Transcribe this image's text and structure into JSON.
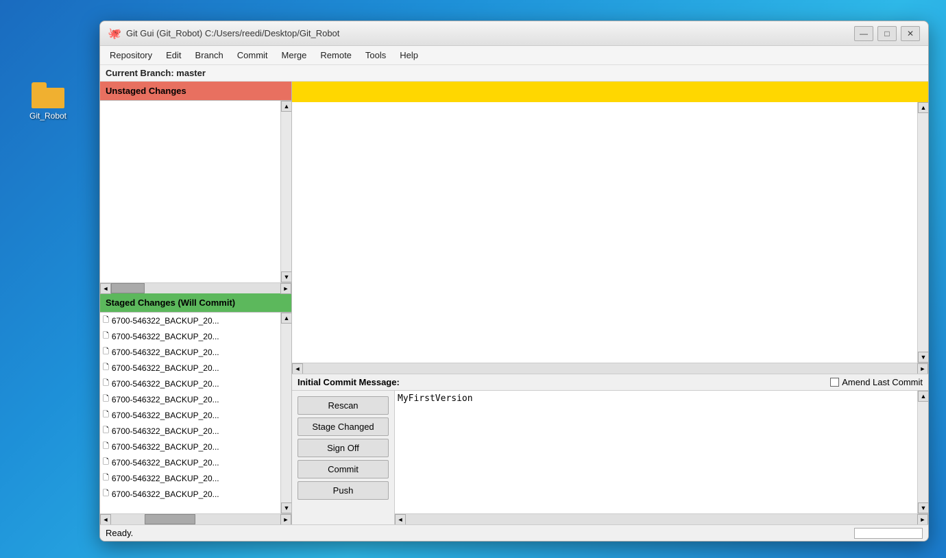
{
  "desktop": {
    "folder_label": "Git_Robot"
  },
  "window": {
    "title": "Git Gui (Git_Robot) C:/Users/reedi/Desktop/Git_Robot",
    "icon": "🐙"
  },
  "titlebar_buttons": {
    "minimize": "—",
    "maximize": "□",
    "close": "✕"
  },
  "menubar": {
    "items": [
      "Repository",
      "Edit",
      "Branch",
      "Commit",
      "Merge",
      "Remote",
      "Tools",
      "Help"
    ]
  },
  "branchbar": {
    "label": "Current Branch: master"
  },
  "left_panel": {
    "unstaged_header": "Unstaged Changes",
    "staged_header": "Staged Changes (Will Commit)",
    "staged_files": [
      "6700-546322_BACKUP_20...",
      "6700-546322_BACKUP_20...",
      "6700-546322_BACKUP_20...",
      "6700-546322_BACKUP_20...",
      "6700-546322_BACKUP_20...",
      "6700-546322_BACKUP_20...",
      "6700-546322_BACKUP_20...",
      "6700-546322_BACKUP_20...",
      "6700-546322_BACKUP_20...",
      "6700-546322_BACKUP_20...",
      "6700-546322_BACKUP_20...",
      "6700-546322_BACKUP_20..."
    ]
  },
  "commit_message": {
    "label": "Initial Commit Message:",
    "amend_label": "Amend Last Commit",
    "value": "MyFirstVersion"
  },
  "action_buttons": {
    "rescan": "Rescan",
    "stage_changed": "Stage Changed",
    "sign_off": "Sign Off",
    "commit": "Commit",
    "push": "Push"
  },
  "statusbar": {
    "status": "Ready."
  }
}
